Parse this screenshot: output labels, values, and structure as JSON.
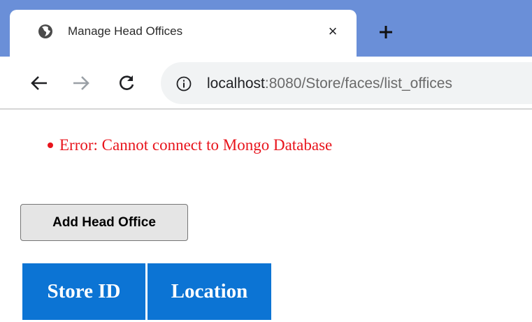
{
  "browser": {
    "tab": {
      "title": "Manage Head Offices",
      "favicon": "globe-icon",
      "close_glyph": "×"
    },
    "new_tab_icon": "plus-icon",
    "nav": {
      "back_icon": "arrow-left-icon",
      "forward_icon": "arrow-right-icon",
      "reload_icon": "reload-icon"
    },
    "address_bar": {
      "info_icon": "info-icon",
      "url_host": "localhost",
      "url_path": ":8080/Store/faces/list_offices"
    },
    "colors": {
      "tabstrip": "#6a8fd8",
      "omnibox": "#f1f3f4"
    }
  },
  "page": {
    "messages": [
      {
        "text": "Error: Cannot connect to Mongo Database"
      }
    ],
    "add_button_label": "Add Head Office",
    "table": {
      "columns": [
        "Store ID",
        "Location"
      ],
      "rows": []
    },
    "colors": {
      "error_text": "#e8141c",
      "table_header_bg": "#0c74d4",
      "table_header_text": "#ffffff"
    }
  }
}
